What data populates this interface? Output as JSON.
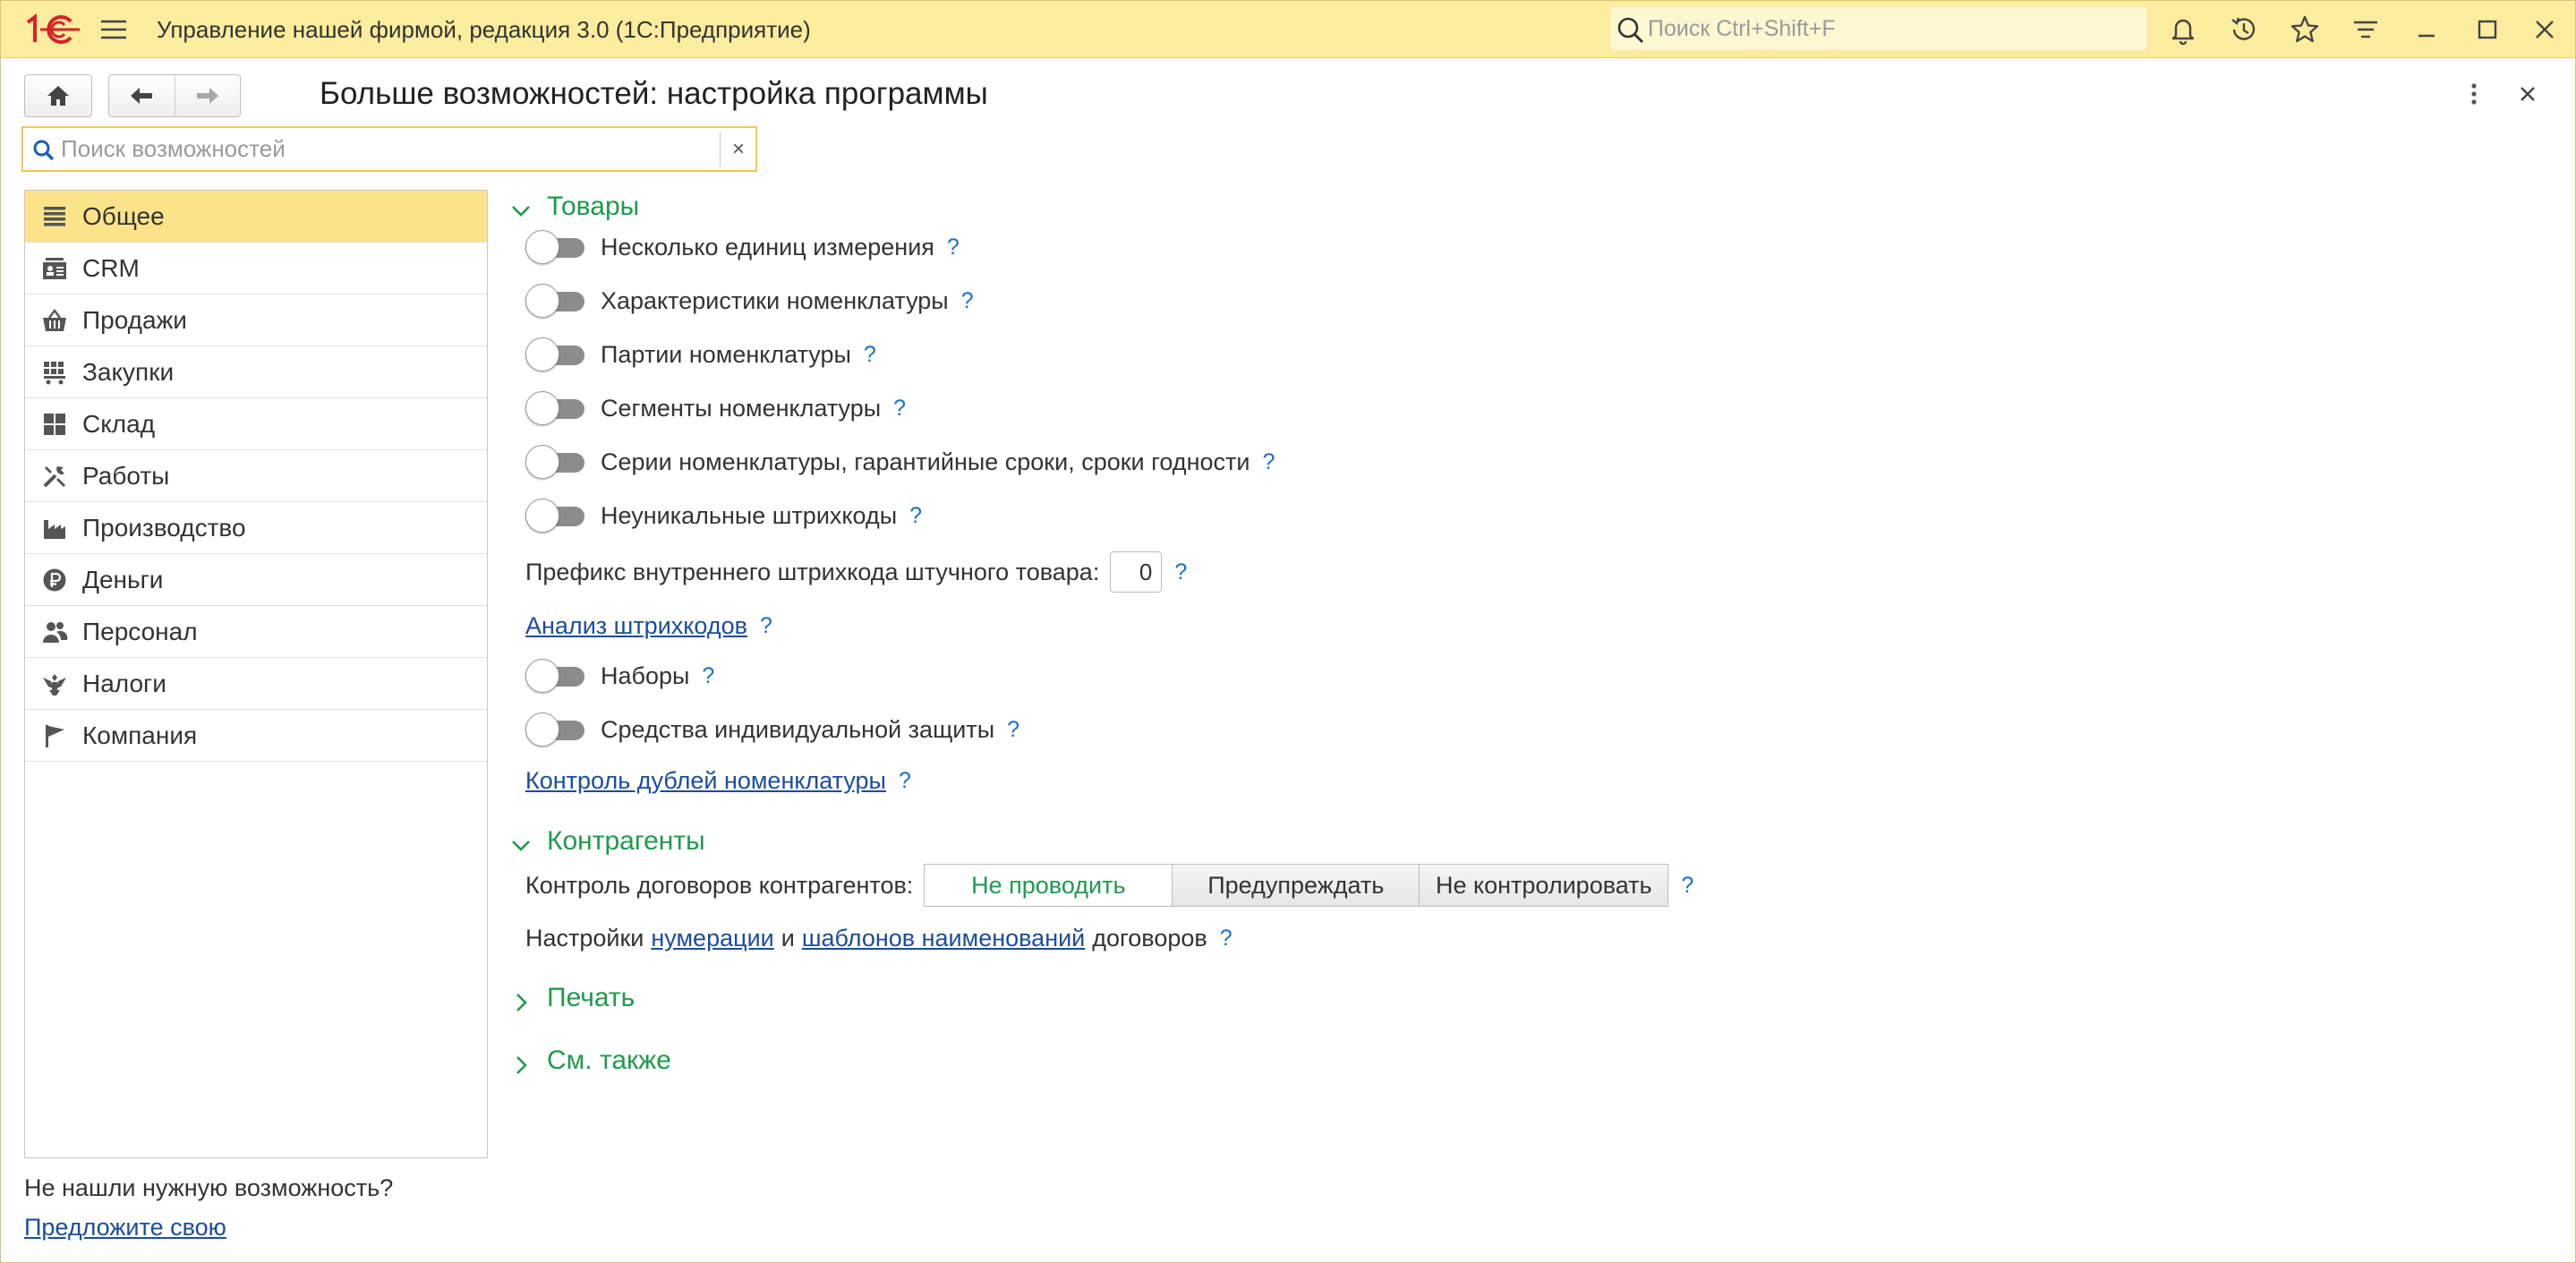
{
  "titlebar": {
    "logo": "1С",
    "title": "Управление нашей фирмой, редакция 3.0  (1С:Предприятие)",
    "search_placeholder": "Поиск Ctrl+Shift+F"
  },
  "header": {
    "page_title": "Больше возможностей: настройка программы",
    "search_placeholder": "Поиск возможностей",
    "clear_label": "×"
  },
  "sidebar": {
    "items": [
      {
        "label": "Общее",
        "icon": "list-icon",
        "active": true
      },
      {
        "label": "CRM",
        "icon": "crm-icon"
      },
      {
        "label": "Продажи",
        "icon": "basket-icon"
      },
      {
        "label": "Закупки",
        "icon": "cart-icon"
      },
      {
        "label": "Склад",
        "icon": "warehouse-icon"
      },
      {
        "label": "Работы",
        "icon": "tools-icon"
      },
      {
        "label": "Производство",
        "icon": "factory-icon"
      },
      {
        "label": "Деньги",
        "icon": "ruble-icon"
      },
      {
        "label": "Персонал",
        "icon": "people-icon"
      },
      {
        "label": "Налоги",
        "icon": "emblem-icon"
      },
      {
        "label": "Компания",
        "icon": "flag-icon"
      }
    ]
  },
  "footer": {
    "not_found": "Не нашли нужную возможность?",
    "suggest_link": "Предложите свою"
  },
  "goods": {
    "title": "Товары",
    "toggles": [
      {
        "label": "Несколько единиц измерения",
        "on": false
      },
      {
        "label": "Характеристики номенклатуры",
        "on": false
      },
      {
        "label": "Партии номенклатуры",
        "on": false
      },
      {
        "label": "Сегменты номенклатуры",
        "on": false
      },
      {
        "label": "Серии номенклатуры, гарантийные сроки, сроки годности",
        "on": false
      },
      {
        "label": "Неуникальные штрихкоды",
        "on": false
      }
    ],
    "prefix_label": "Префикс внутреннего штрихкода штучного товара:",
    "prefix_value": "0",
    "barcode_analysis_link": "Анализ штрихкодов",
    "toggles2": [
      {
        "label": "Наборы",
        "on": false
      },
      {
        "label": "Средства индивидуальной защиты",
        "on": false
      }
    ],
    "duplicates_link": "Контроль дублей номенклатуры",
    "help": "?"
  },
  "counterparties": {
    "title": "Контрагенты",
    "contracts_label": "Контроль договоров контрагентов:",
    "options": [
      "Не проводить",
      "Предупреждать",
      "Не контролировать"
    ],
    "selected": "Не проводить",
    "settings_prefix": "Настройки",
    "numbering_link": "нумерации",
    "and_text": "и",
    "templates_link": "шаблонов наименований",
    "settings_suffix": "договоров"
  },
  "print": {
    "title": "Печать"
  },
  "see_also": {
    "title": "См. также"
  },
  "colors": {
    "titlebar": "#fbed9e",
    "active_item": "#fbe38a",
    "group_green": "#1f9a4d",
    "link_blue": "#1a4d9c",
    "help_blue": "#1a6fc7",
    "search_border": "#f2c94c"
  }
}
